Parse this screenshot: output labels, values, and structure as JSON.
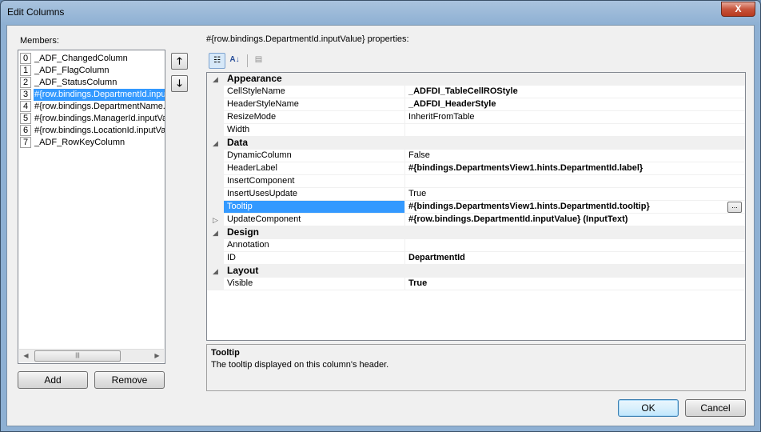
{
  "window": {
    "title": "Edit Columns",
    "close_glyph": "X"
  },
  "members": {
    "label": "Members:",
    "items": [
      {
        "index": "0",
        "name": "_ADF_ChangedColumn"
      },
      {
        "index": "1",
        "name": "_ADF_FlagColumn"
      },
      {
        "index": "2",
        "name": "_ADF_StatusColumn"
      },
      {
        "index": "3",
        "name": "#{row.bindings.DepartmentId.inputValue}"
      },
      {
        "index": "4",
        "name": "#{row.bindings.DepartmentName.inputValue}"
      },
      {
        "index": "5",
        "name": "#{row.bindings.ManagerId.inputValue}"
      },
      {
        "index": "6",
        "name": "#{row.bindings.LocationId.inputValue}"
      },
      {
        "index": "7",
        "name": "_ADF_RowKeyColumn"
      }
    ],
    "selected_index": 3,
    "add_label": "Add",
    "remove_label": "Remove"
  },
  "properties": {
    "label": "#{row.bindings.DepartmentId.inputValue} properties:",
    "rows": [
      {
        "kind": "category",
        "name": "Appearance"
      },
      {
        "kind": "prop",
        "name": "CellStyleName",
        "value": "_ADFDI_TableCellROStyle",
        "bold": true
      },
      {
        "kind": "prop",
        "name": "HeaderStyleName",
        "value": "_ADFDI_HeaderStyle",
        "bold": true
      },
      {
        "kind": "prop",
        "name": "ResizeMode",
        "value": "InheritFromTable",
        "bold": false
      },
      {
        "kind": "prop",
        "name": "Width",
        "value": "",
        "bold": false
      },
      {
        "kind": "category",
        "name": "Data"
      },
      {
        "kind": "prop",
        "name": "DynamicColumn",
        "value": "False",
        "bold": false
      },
      {
        "kind": "prop",
        "name": "HeaderLabel",
        "value": "#{bindings.DepartmentsView1.hints.DepartmentId.label}",
        "bold": true
      },
      {
        "kind": "prop",
        "name": "InsertComponent",
        "value": "",
        "bold": false
      },
      {
        "kind": "prop",
        "name": "InsertUsesUpdate",
        "value": "True",
        "bold": false
      },
      {
        "kind": "prop",
        "name": "Tooltip",
        "value": "#{bindings.DepartmentsView1.hints.DepartmentId.tooltip}",
        "bold": true,
        "selected": true,
        "ellipsis": "..."
      },
      {
        "kind": "prop",
        "name": "UpdateComponent",
        "value": "#{row.bindings.DepartmentId.inputValue} (InputText)",
        "bold": true,
        "expandable": true
      },
      {
        "kind": "category",
        "name": "Design"
      },
      {
        "kind": "prop",
        "name": "Annotation",
        "value": "",
        "bold": false
      },
      {
        "kind": "prop",
        "name": "ID",
        "value": "DepartmentId",
        "bold": true
      },
      {
        "kind": "category",
        "name": "Layout"
      },
      {
        "kind": "prop",
        "name": "Visible",
        "value": "True",
        "bold": true
      }
    ]
  },
  "description": {
    "title": "Tooltip",
    "text": "The tooltip displayed on this column's header."
  },
  "buttons": {
    "ok": "OK",
    "cancel": "Cancel"
  }
}
